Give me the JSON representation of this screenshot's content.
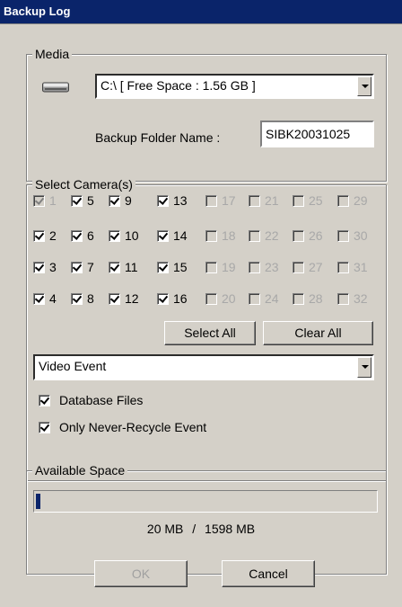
{
  "window": {
    "title": "Backup Log"
  },
  "media": {
    "legend": "Media",
    "drive_value": "C:\\ [ Free Space : 1.56 GB ]",
    "folder_label": "Backup Folder Name :",
    "folder_value": "SIBK20031025"
  },
  "cameras": {
    "legend": "Select Camera(s)",
    "items": [
      {
        "label": "1",
        "checked": true,
        "enabled": false
      },
      {
        "label": "2",
        "checked": true,
        "enabled": true
      },
      {
        "label": "3",
        "checked": true,
        "enabled": true
      },
      {
        "label": "4",
        "checked": true,
        "enabled": true
      },
      {
        "label": "5",
        "checked": true,
        "enabled": true
      },
      {
        "label": "6",
        "checked": true,
        "enabled": true
      },
      {
        "label": "7",
        "checked": true,
        "enabled": true
      },
      {
        "label": "8",
        "checked": true,
        "enabled": true
      },
      {
        "label": "9",
        "checked": true,
        "enabled": true
      },
      {
        "label": "10",
        "checked": true,
        "enabled": true
      },
      {
        "label": "11",
        "checked": true,
        "enabled": true
      },
      {
        "label": "12",
        "checked": true,
        "enabled": true
      },
      {
        "label": "13",
        "checked": true,
        "enabled": true
      },
      {
        "label": "14",
        "checked": true,
        "enabled": true
      },
      {
        "label": "15",
        "checked": true,
        "enabled": true
      },
      {
        "label": "16",
        "checked": true,
        "enabled": true
      },
      {
        "label": "17",
        "checked": false,
        "enabled": false
      },
      {
        "label": "18",
        "checked": false,
        "enabled": false
      },
      {
        "label": "19",
        "checked": false,
        "enabled": false
      },
      {
        "label": "20",
        "checked": false,
        "enabled": false
      },
      {
        "label": "21",
        "checked": false,
        "enabled": false
      },
      {
        "label": "22",
        "checked": false,
        "enabled": false
      },
      {
        "label": "23",
        "checked": false,
        "enabled": false
      },
      {
        "label": "24",
        "checked": false,
        "enabled": false
      },
      {
        "label": "25",
        "checked": false,
        "enabled": false
      },
      {
        "label": "26",
        "checked": false,
        "enabled": false
      },
      {
        "label": "27",
        "checked": false,
        "enabled": false
      },
      {
        "label": "28",
        "checked": false,
        "enabled": false
      },
      {
        "label": "29",
        "checked": false,
        "enabled": false
      },
      {
        "label": "30",
        "checked": false,
        "enabled": false
      },
      {
        "label": "31",
        "checked": false,
        "enabled": false
      },
      {
        "label": "32",
        "checked": false,
        "enabled": false
      }
    ],
    "select_all_label": "Select All",
    "clear_all_label": "Clear All",
    "event_type_value": "Video Event",
    "database_files_label": "Database Files",
    "database_files_checked": true,
    "never_recycle_label": "Only Never-Recycle Event",
    "never_recycle_checked": true
  },
  "space": {
    "legend": "Available Space",
    "used_fraction": 0.0125,
    "used_text": "20 MB",
    "separator": "/",
    "total_text": "1598 MB"
  },
  "buttons": {
    "ok_label": "OK",
    "cancel_label": "Cancel"
  },
  "icons": {
    "drive": "hard-drive-icon",
    "dropdown": "chevron-down-icon"
  },
  "colors": {
    "titlebar": "#0a246a",
    "face": "#d4d0c8",
    "progress": "#0a246a"
  }
}
